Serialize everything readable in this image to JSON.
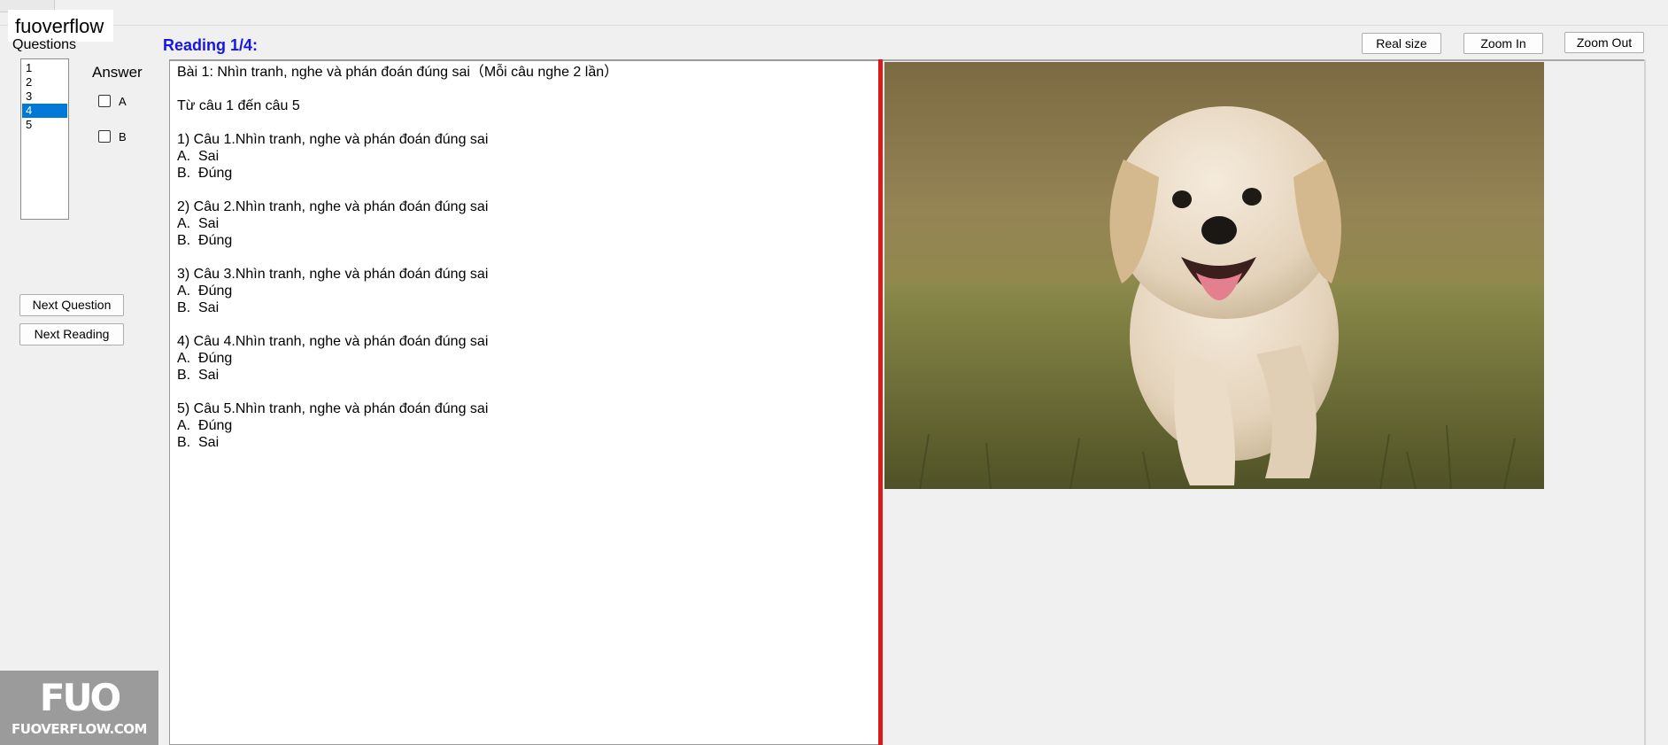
{
  "window": {
    "menu_label": "",
    "watermark_text": "fuoverflow"
  },
  "sidebar": {
    "questions_label": "Questions",
    "question_items": [
      "1",
      "2",
      "3",
      "4",
      "5"
    ],
    "selected_index": 3,
    "answer_label": "Answer",
    "options": [
      {
        "label": "A",
        "checked": false
      },
      {
        "label": "B",
        "checked": false
      }
    ],
    "next_question_label": "Next Question",
    "next_reading_label": "Next Reading"
  },
  "reading": {
    "title": "Reading 1/4:",
    "lines": [
      "Bài 1: Nhìn tranh, nghe và phán đoán đúng sai（Mỗi câu nghe 2 lần）",
      "",
      "Từ câu 1 đến câu 5",
      "",
      "1) Câu 1.Nhìn tranh, nghe và phán đoán đúng sai",
      "A.  Sai",
      "B.  Đúng",
      "",
      "2) Câu 2.Nhìn tranh, nghe và phán đoán đúng sai",
      "A.  Sai",
      "B.  Đúng",
      "",
      "3) Câu 3.Nhìn tranh, nghe và phán đoán đúng sai",
      "A.  Đúng",
      "B.  Sai",
      "",
      "4) Câu 4.Nhìn tranh, nghe và phán đoán đúng sai",
      "A.  Đúng",
      "B.  Sai",
      "",
      "5) Câu 5.Nhìn tranh, nghe và phán đoán đúng sai",
      "A.  Đúng",
      "B.  Sai"
    ]
  },
  "image_toolbar": {
    "real_size_label": "Real size",
    "zoom_in_label": "Zoom In",
    "zoom_out_label": "Zoom Out"
  },
  "branding": {
    "logo_mark": "FUO",
    "logo_text": "FUOVERFLOW.COM"
  },
  "colors": {
    "selection": "#0078d7",
    "reading_title": "#1515e6",
    "divider": "#dd1a1a"
  }
}
